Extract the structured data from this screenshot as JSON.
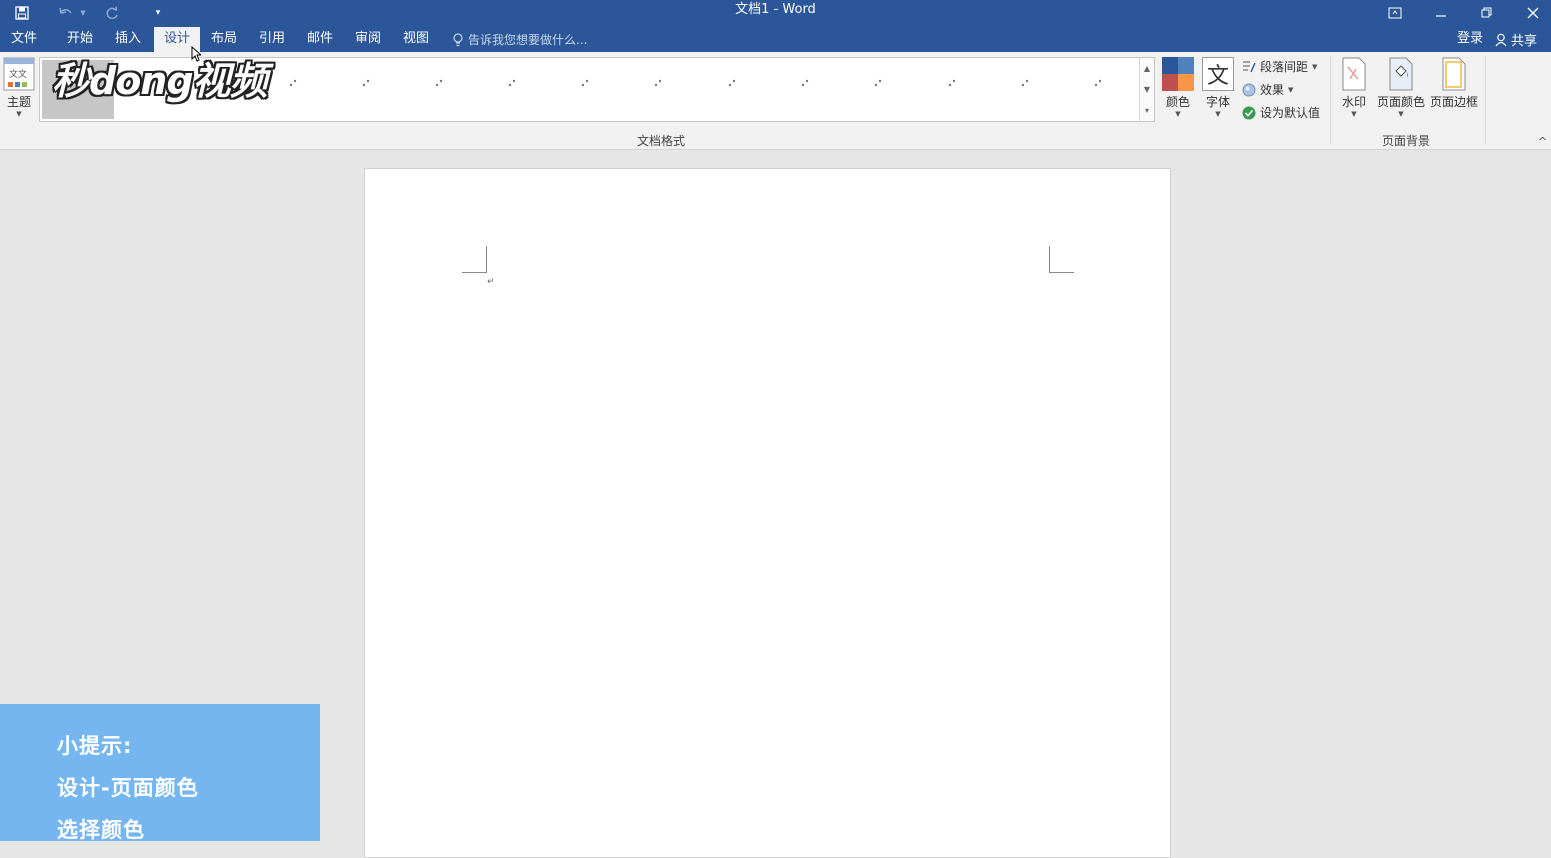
{
  "window": {
    "title": "文档1 - Word"
  },
  "tabs": [
    {
      "label": "文件"
    },
    {
      "label": "开始"
    },
    {
      "label": "插入"
    },
    {
      "label": "设计"
    },
    {
      "label": "布局"
    },
    {
      "label": "引用"
    },
    {
      "label": "邮件"
    },
    {
      "label": "审阅"
    },
    {
      "label": "视图"
    }
  ],
  "active_tab": "设计",
  "tell_me": {
    "placeholder": "告诉我您想要做什么..."
  },
  "account": {
    "login": "登录",
    "share": "共享"
  },
  "ribbon": {
    "theme_label": "主题",
    "theme_icon_text": "文文",
    "colors_label": "颜色",
    "fonts_label": "字体",
    "fonts_icon_text": "文",
    "paragraph_spacing": "段落间距",
    "effects": "效果",
    "set_default": "设为默认值",
    "watermark": "水印",
    "page_color": "页面颜色",
    "page_borders": "页面边框",
    "group_document_format": "文档格式",
    "group_page_background": "页面背景"
  },
  "overlay": {
    "logo_text": "秒dong视频",
    "tip": {
      "line1": "小提示:",
      "line2": "设计-页面颜色",
      "line3": "选择颜色"
    }
  },
  "colors": {
    "title_bar": "#2b579a",
    "ribbon": "#f1f1f1",
    "canvas": "#e6e6e6",
    "tip_background": "#75b6f0"
  }
}
